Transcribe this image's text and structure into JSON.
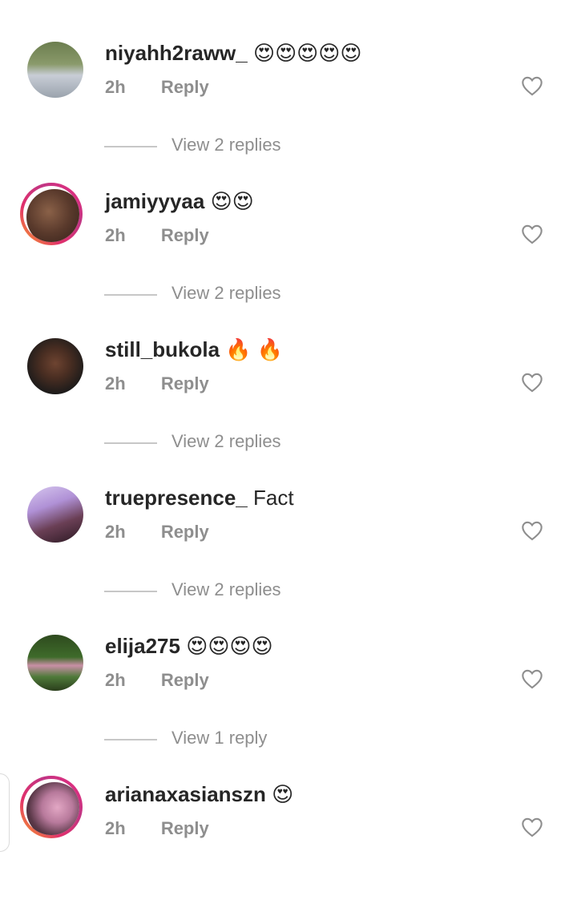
{
  "comments": [
    {
      "username": "niyahh2raww_",
      "text": "😍😍😍😍😍",
      "time": "2h",
      "reply_label": "Reply",
      "replies_label": "View 2 replies",
      "avatar_story": false,
      "avatar_colors": [
        "#6b7d4e",
        "#c8cdd6"
      ]
    },
    {
      "username": "jamiyyyaa",
      "text": "😍😍",
      "time": "2h",
      "reply_label": "Reply",
      "replies_label": "View 2 replies",
      "avatar_story": true,
      "avatar_colors": [
        "#5a3a2c",
        "#2a1b15"
      ]
    },
    {
      "username": "still_bukola",
      "text": "🔥 🔥",
      "time": "2h",
      "reply_label": "Reply",
      "replies_label": "View 2 replies",
      "avatar_story": false,
      "avatar_colors": [
        "#4a2e22",
        "#1a1a1a"
      ]
    },
    {
      "username": "truepresence_",
      "text": "Fact",
      "time": "2h",
      "reply_label": "Reply",
      "replies_label": "View 2 replies",
      "avatar_story": false,
      "avatar_colors": [
        "#b091d6",
        "#2a1822"
      ]
    },
    {
      "username": "elija275",
      "text": "😍😍😍😍",
      "time": "2h",
      "reply_label": "Reply",
      "replies_label": "View 1 reply",
      "avatar_story": false,
      "avatar_colors": [
        "#3e6b2a",
        "#c98fa6"
      ]
    },
    {
      "username": "arianaxasianszn",
      "text": "😍",
      "time": "2h",
      "reply_label": "Reply",
      "replies_label": "",
      "avatar_story": true,
      "avatar_colors": [
        "#b87a9c",
        "#2c1e24"
      ]
    }
  ],
  "icons": {
    "like": "heart-outline-icon"
  },
  "colors": {
    "secondary_text": "#8e8e8e",
    "primary_text": "#262626",
    "story_ring": "#e1306c"
  }
}
